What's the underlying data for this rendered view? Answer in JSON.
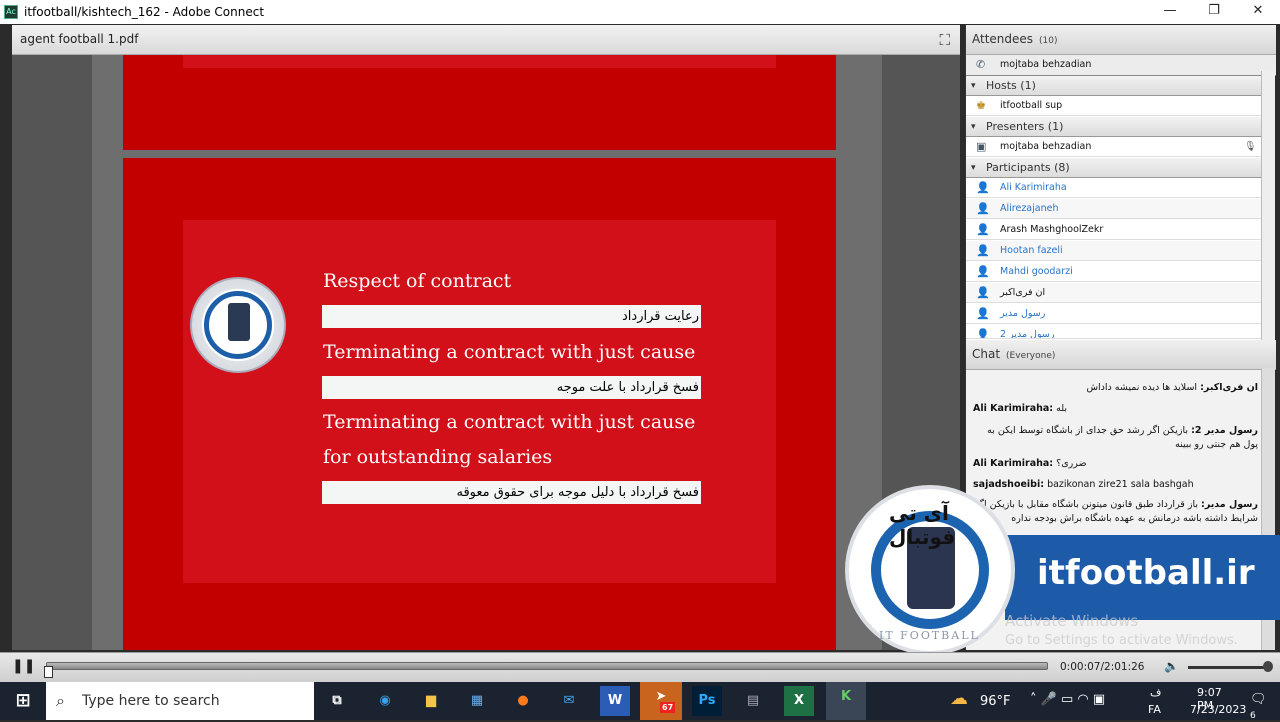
{
  "window": {
    "title": "itfootball/kishtech_162 - Adobe Connect",
    "minimize": "—",
    "restore": "❐",
    "close": "✕"
  },
  "share_pod": {
    "title": "agent football 1.pdf",
    "fullscreen_icon": "fullscreen-icon"
  },
  "slide": {
    "items": [
      {
        "en": "Respect of contract",
        "fa": "رعایت قرارداد"
      },
      {
        "en": "Terminating a contract with just cause",
        "fa": "فسخ قرارداد با علت موجه"
      },
      {
        "en": "Terminating a contract with just cause",
        "en2": "for outstanding  salaries",
        "fa": "فسخ قرارداد با دلیل موجه برای حقوق معوقه"
      }
    ],
    "logo_text": "IT FOOTBALL",
    "colors": {
      "slide_red": "#c20000",
      "inner_red": "#d2101a"
    }
  },
  "attendees": {
    "title": "Attendees",
    "count": "(10)",
    "me": "mojtaba behzadian",
    "groups": [
      {
        "label": "Hosts (1)",
        "members": [
          {
            "name": "itfootball sup",
            "blue": false
          }
        ]
      },
      {
        "label": "Presenters (1)",
        "members": [
          {
            "name": "mojtaba behzadian",
            "blue": false
          }
        ]
      },
      {
        "label": "Participants (8)",
        "members": [
          {
            "name": "Ali Karimiraha",
            "blue": true
          },
          {
            "name": "Alirezajaneh",
            "blue": true
          },
          {
            "name": "Arash MashghoolZekr",
            "blue": false
          },
          {
            "name": "Hootan fazeli",
            "blue": true
          },
          {
            "name": "Mahdi goodarzi",
            "blue": true
          },
          {
            "name": "ان فری‌اکبر",
            "blue": false
          },
          {
            "name": "رسول مدیر",
            "blue": true
          },
          {
            "name": "رسول مدیر 2",
            "blue": true
          }
        ]
      }
    ]
  },
  "chat": {
    "title": "Chat",
    "scope": "(Everyone)",
    "messages": [
      {
        "sender": "ان فری‌اکبر:",
        "text": "اسلاید ها دیده نمیشه داداش",
        "rtl": true
      },
      {
        "sender": "Ali Karimiraha:",
        "text": "بله",
        "rtl": false
      },
      {
        "sender": "رسول مدیر 2:",
        "text": "بازیکن اگر رشد حق جدای از باشگاه توسط ایکن به پول هم جنتی رو ببینه",
        "rtl": true
      },
      {
        "sender": "Ali Karimiraha:",
        "text": "ضرری؟",
        "rtl": false
      },
      {
        "sender": "sajadshoeibi:",
        "text": "bazikonan zire21 sala bashgah",
        "rtl": false
      },
      {
        "sender": "رسول مدیر:",
        "text": "باز قرارداد طبق قانون میتونن باشگاه مقابل با بازیکن اگه شرایط داشته باشه درمانش به عهده باشگاه براش بودجه نداره",
        "rtl": true
      }
    ]
  },
  "watermark": {
    "brand_fa": "آی تی فوتبال",
    "brand_en": "IT FOOTBALL",
    "site": "itfootball.ir",
    "accent": "#1d5aa8"
  },
  "activation": {
    "line1": "Activate Windows",
    "line2": "Go to Settings to activate Windows."
  },
  "player": {
    "time": "0:00:07/2:01:26",
    "progress": 0.001,
    "volume": 1.0
  },
  "taskbar": {
    "search_placeholder": "Type here to search",
    "apps": [
      "task-view",
      "edge",
      "file-explorer",
      "store",
      "firefox",
      "mail",
      "word",
      "telegram",
      "photoshop",
      "calculator",
      "excel",
      "adobe-connect"
    ],
    "telegram_badge": "67",
    "weather": "96°F",
    "lang_top": "ف",
    "lang": "FA",
    "time": "9:07 PM",
    "date": "7/23/2023",
    "notifications": "6"
  }
}
